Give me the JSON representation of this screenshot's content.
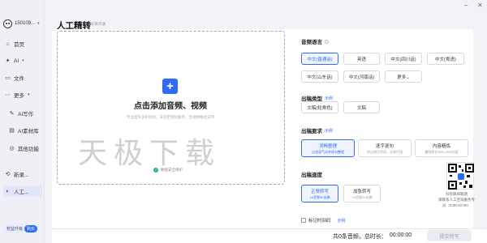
{
  "user": {
    "name": "150109..."
  },
  "sidebar": {
    "items": [
      {
        "label": "首页",
        "icon": "home-icon",
        "glyph": "⌂"
      },
      {
        "label": "AI",
        "icon": "ai-sparkle-icon",
        "glyph": "✦"
      },
      {
        "label": "文件",
        "icon": "folder-icon",
        "glyph": "▭"
      },
      {
        "label": "更多",
        "icon": "more-grid-icon",
        "glyph": "⋯"
      },
      {
        "label": "AI写作",
        "icon": "pen-icon",
        "glyph": "✎"
      },
      {
        "label": "AI素材库",
        "icon": "library-icon",
        "glyph": "▤"
      },
      {
        "label": "其他功能",
        "icon": "apps-icon",
        "glyph": "◎"
      },
      {
        "label": "新录...",
        "icon": "record-icon",
        "glyph": "⟲"
      },
      {
        "label": "人工...",
        "icon": "person-icon",
        "glyph": "◐"
      }
    ],
    "vip_text": "权益升级",
    "vip_button": "购买"
  },
  "window": {
    "minimize": "–",
    "close": "✕"
  },
  "page": {
    "title": "人工精转",
    "subtitle": "如果开通",
    "watermark": "天极下载"
  },
  "upload": {
    "plus": "+",
    "title": "点击添加音频、视频",
    "subtitle": "专业团队多轮校验，支持定制化服务，音视频格式支持",
    "security": "数据安全保护"
  },
  "sections": {
    "language": {
      "title": "音频语言",
      "help": "?",
      "options": [
        "中文(普通话)",
        "英语",
        "中文(四川话)",
        "中文(粤语)",
        "中文(山东话)",
        "中文(河南话)",
        "更多⌄"
      ]
    },
    "type": {
      "title": "出稿类型",
      "link": "示例",
      "options": [
        "文稿(轮角色)",
        "文稿"
      ]
    },
    "requirement": {
      "title": "出稿要求",
      "link": "示例",
      "options": [
        {
          "a": "流畅整理",
          "b": "过滤语气词并逐句整理"
        },
        {
          "a": "逐字逐句",
          "b": "仅过滤冗余词，无效片段"
        },
        {
          "a": "内容精炼",
          "b": "删除原文30%-40%内容"
        }
      ]
    },
    "speed": {
      "title": "出稿速度",
      "options": [
        {
          "a": "正常转写",
          "b": "1h音频3h出稿"
        },
        {
          "a": "加急转写",
          "b": "1h音频2h出稿"
        }
      ]
    },
    "timestamp": {
      "label": "标记时间码",
      "link": "示例"
    }
  },
  "support": {
    "line1": "扫有稿商稿请",
    "line2": "请联系人工咨询服务专",
    "line3": "员（9:00-22:00）"
  },
  "footer": {
    "summary_prefix": "共0条音频，总时长：",
    "duration": "00:00:00",
    "submit": "提交转写"
  }
}
